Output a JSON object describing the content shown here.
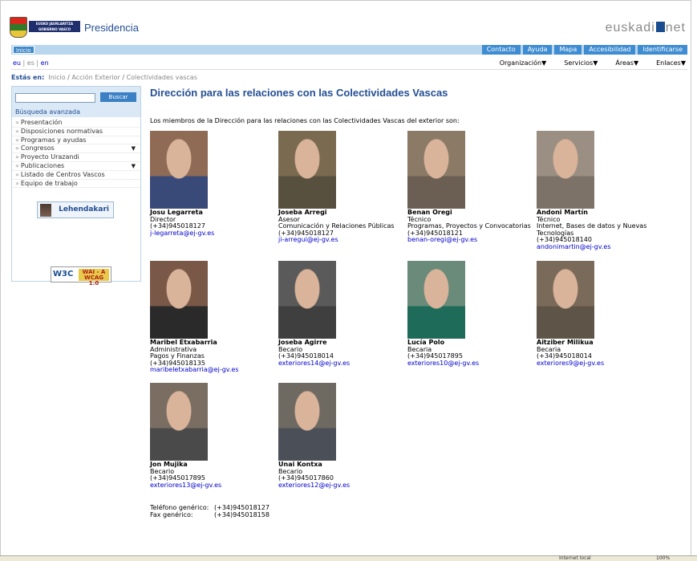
{
  "header": {
    "logo_text": "EUSKO JAURLARITZA GOBIERNO VASCO",
    "site_title": "Presidencia",
    "brand_left": "euskadi",
    "brand_right": "net"
  },
  "nav": {
    "inicio": "Inicio",
    "tabs": [
      "Contacto",
      "Ayuda",
      "Mapa",
      "Accesibilidad",
      "Identificarse"
    ],
    "langs": [
      "eu",
      "es",
      "en"
    ],
    "menus": [
      "Organización",
      "Servicios",
      "Áreas",
      "Enlaces"
    ]
  },
  "breadcrumb": {
    "label": "Estás en:",
    "items": [
      "Inicio",
      "Acción Exterior",
      "Colectividades vascas"
    ]
  },
  "sidebar": {
    "search_button": "Buscar",
    "advanced": "Búsqueda avanzada",
    "items": [
      {
        "label": "Presentación"
      },
      {
        "label": "Disposiciones normativas"
      },
      {
        "label": "Programas y ayudas"
      },
      {
        "label": "Congresos"
      },
      {
        "label": "Proyecto Urazandi"
      },
      {
        "label": "Publicaciones"
      },
      {
        "label": "Listado de Centros Vascos"
      },
      {
        "label": "Equipo de trabajo"
      }
    ],
    "lehendakari": "Lehendakari",
    "wai_logo": "W3C",
    "wai_badge_1": "WAI - A",
    "wai_badge_2": "WCAG 1.0"
  },
  "main": {
    "title": "Dirección para las relaciones con las Colectividades Vascas",
    "intro": "Los miembros de la Dirección para las relaciones con las Colectividades Vascas del exterior son:",
    "members": [
      {
        "name": "Josu Legarreta",
        "role": "Director",
        "area": "",
        "phone": "(+34)945018127",
        "email": "j-legarreta@ej-gv.es"
      },
      {
        "name": "Joseba Arregi",
        "role": "Asesor",
        "area": "Comunicación y Relaciones Públicas",
        "phone": "(+34)945018127",
        "email": "ji-arregui@ej-gv.es"
      },
      {
        "name": "Benan Oregi",
        "role": "Técnico",
        "area": "Programas, Proyectos y Convocatorias",
        "phone": "(+34)945018121",
        "email": "benan-oregi@ej-gv.es"
      },
      {
        "name": "Andoni Martín",
        "role": "Técnico",
        "area": "Internet, Bases de datos y Nuevas Tecnologías",
        "phone": "(+34)945018140",
        "email": "andonimartin@ej-gv.es"
      },
      {
        "name": "Maribel Etxabarria",
        "role": "Administrativa",
        "area": "Pagos y Finanzas",
        "phone": "(+34)945018135",
        "email": "maribeletxabarria@ej-gv.es"
      },
      {
        "name": "Joseba Agirre",
        "role": "Becario",
        "area": "",
        "phone": "(+34)945018014",
        "email": "exteriores14@ej-gv.es"
      },
      {
        "name": "Lucía Polo",
        "role": "Becaria",
        "area": "",
        "phone": "(+34)945017895",
        "email": "exteriores10@ej-gv.es"
      },
      {
        "name": "Aitziber Milikua",
        "role": "Becaria",
        "area": "",
        "phone": "(+34)945018014",
        "email": "exteriores9@ej-gv.es"
      },
      {
        "name": "Jon Mujika",
        "role": "Becario",
        "area": "",
        "phone": "(+34)945017895",
        "email": "exteriores13@ej-gv.es"
      },
      {
        "name": "Unai Kontxa",
        "role": "Becario",
        "area": "",
        "phone": "(+34)945017860",
        "email": "exteriores12@ej-gv.es"
      }
    ],
    "phone_label": "Teléfono genérico:",
    "phone_value": "(+34)945018127",
    "fax_label": "Fax genérico:",
    "fax_value": "(+34)945018158"
  },
  "statusbar": {
    "zone": "Internet local",
    "zoom": "100%"
  },
  "colors": {
    "accent": "#3e8cd1",
    "title": "#244f94",
    "navband": "#b8d7ef"
  }
}
